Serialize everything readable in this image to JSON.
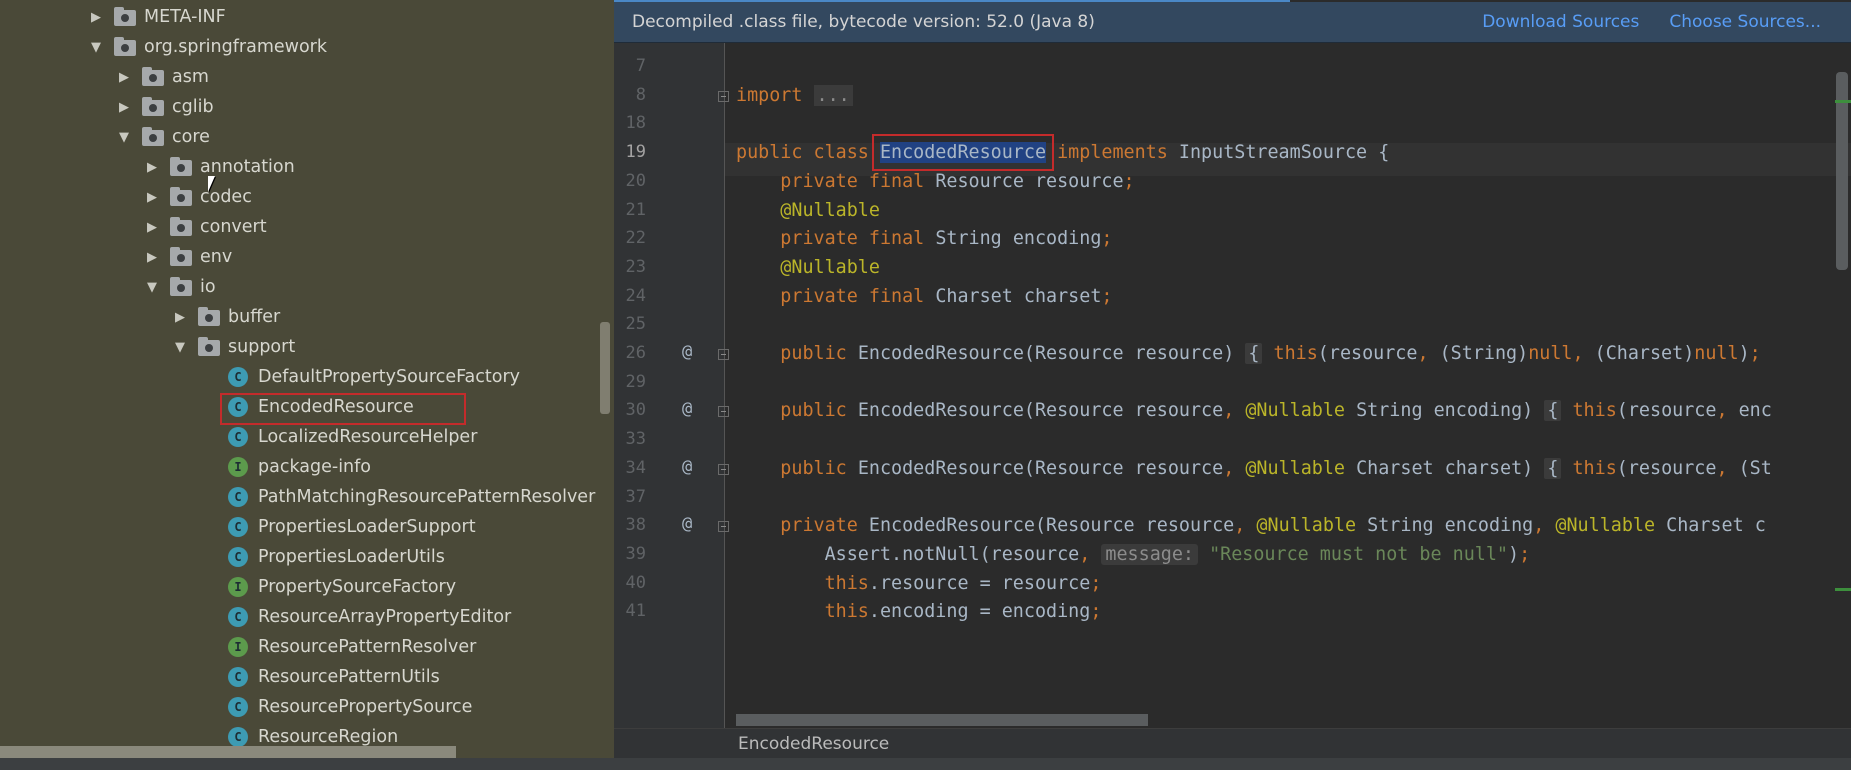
{
  "tree": {
    "rows": [
      {
        "depth": 0,
        "arrow": "right",
        "icon": "folder",
        "label": "META-INF"
      },
      {
        "depth": 0,
        "arrow": "down",
        "icon": "folder",
        "label": "org.springframework"
      },
      {
        "depth": 1,
        "arrow": "right",
        "icon": "folder",
        "label": "asm"
      },
      {
        "depth": 1,
        "arrow": "right",
        "icon": "folder",
        "label": "cglib"
      },
      {
        "depth": 1,
        "arrow": "down",
        "icon": "folder",
        "label": "core"
      },
      {
        "depth": 2,
        "arrow": "right",
        "icon": "folder",
        "label": "annotation"
      },
      {
        "depth": 2,
        "arrow": "right",
        "icon": "folder",
        "label": "codec"
      },
      {
        "depth": 2,
        "arrow": "right",
        "icon": "folder",
        "label": "convert"
      },
      {
        "depth": 2,
        "arrow": "right",
        "icon": "folder",
        "label": "env"
      },
      {
        "depth": 2,
        "arrow": "down",
        "icon": "folder",
        "label": "io"
      },
      {
        "depth": 3,
        "arrow": "right",
        "icon": "folder",
        "label": "buffer"
      },
      {
        "depth": 3,
        "arrow": "down",
        "icon": "folder",
        "label": "support"
      },
      {
        "depth": 4,
        "arrow": "none",
        "icon": "class",
        "label": "DefaultPropertySourceFactory"
      },
      {
        "depth": 4,
        "arrow": "none",
        "icon": "class",
        "label": "EncodedResource",
        "selected": true
      },
      {
        "depth": 4,
        "arrow": "none",
        "icon": "class",
        "label": "LocalizedResourceHelper"
      },
      {
        "depth": 4,
        "arrow": "none",
        "icon": "interface",
        "label": "package-info"
      },
      {
        "depth": 4,
        "arrow": "none",
        "icon": "class",
        "label": "PathMatchingResourcePatternResolver"
      },
      {
        "depth": 4,
        "arrow": "none",
        "icon": "class",
        "label": "PropertiesLoaderSupport"
      },
      {
        "depth": 4,
        "arrow": "none",
        "icon": "class",
        "label": "PropertiesLoaderUtils"
      },
      {
        "depth": 4,
        "arrow": "none",
        "icon": "interface",
        "label": "PropertySourceFactory"
      },
      {
        "depth": 4,
        "arrow": "none",
        "icon": "class",
        "label": "ResourceArrayPropertyEditor"
      },
      {
        "depth": 4,
        "arrow": "none",
        "icon": "interface",
        "label": "ResourcePatternResolver"
      },
      {
        "depth": 4,
        "arrow": "none",
        "icon": "class",
        "label": "ResourcePatternUtils"
      },
      {
        "depth": 4,
        "arrow": "none",
        "icon": "class",
        "label": "ResourcePropertySource"
      },
      {
        "depth": 4,
        "arrow": "none",
        "icon": "class",
        "label": "ResourceRegion"
      }
    ]
  },
  "banner": {
    "message": "Decompiled .class file, bytecode version: 52.0 (Java 8)",
    "download_sources": "Download Sources",
    "choose_sources": "Choose Sources..."
  },
  "editor": {
    "current_line": "19",
    "lines": [
      {
        "n": "7",
        "mark": "",
        "fold": false,
        "html": ""
      },
      {
        "n": "8",
        "mark": "",
        "fold": true,
        "html": "<span class=\"kw\">import </span><span class=\"dots\">...</span>"
      },
      {
        "n": "18",
        "mark": "",
        "fold": false,
        "html": ""
      },
      {
        "n": "19",
        "mark": "",
        "fold": false,
        "html": "<span class=\"kw\">public class </span><span class=\"hl\">EncodedResource</span> <span class=\"kw\">implements </span>InputStreamSource {"
      },
      {
        "n": "20",
        "mark": "",
        "fold": false,
        "html": "    <span class=\"kw\">private final </span>Resource resource<span class=\"kw\">;</span>"
      },
      {
        "n": "21",
        "mark": "",
        "fold": false,
        "html": "    <span class=\"ann\">@Nullable</span>"
      },
      {
        "n": "22",
        "mark": "",
        "fold": false,
        "html": "    <span class=\"kw\">private final </span>String encoding<span class=\"kw\">;</span>"
      },
      {
        "n": "23",
        "mark": "",
        "fold": false,
        "html": "    <span class=\"ann\">@Nullable</span>"
      },
      {
        "n": "24",
        "mark": "",
        "fold": false,
        "html": "    <span class=\"kw\">private final </span>Charset charset<span class=\"kw\">;</span>"
      },
      {
        "n": "25",
        "mark": "",
        "fold": false,
        "html": ""
      },
      {
        "n": "26",
        "mark": "@",
        "fold": true,
        "html": "    <span class=\"kw\">public </span>EncodedResource(Resource resource) <span class=\"brace\">{</span> <span class=\"kw\">this</span>(resource<span class=\"kw\">, </span>(String)<span class=\"kw\">null, </span>(Charset)<span class=\"kw\">null</span>)<span class=\"kw\">;</span>"
      },
      {
        "n": "29",
        "mark": "",
        "fold": false,
        "html": ""
      },
      {
        "n": "30",
        "mark": "@",
        "fold": true,
        "html": "    <span class=\"kw\">public </span>EncodedResource(Resource resource<span class=\"kw\">, </span><span class=\"ann\">@Nullable </span>String encoding) <span class=\"brace\">{</span> <span class=\"kw\">this</span>(resource<span class=\"kw\">, </span>enc"
      },
      {
        "n": "33",
        "mark": "",
        "fold": false,
        "html": ""
      },
      {
        "n": "34",
        "mark": "@",
        "fold": true,
        "html": "    <span class=\"kw\">public </span>EncodedResource(Resource resource<span class=\"kw\">, </span><span class=\"ann\">@Nullable </span>Charset charset) <span class=\"brace\">{</span> <span class=\"kw\">this</span>(resource<span class=\"kw\">, </span>(St"
      },
      {
        "n": "37",
        "mark": "",
        "fold": false,
        "html": ""
      },
      {
        "n": "38",
        "mark": "@",
        "fold": true,
        "html": "    <span class=\"kw\">private </span>EncodedResource(Resource resource<span class=\"kw\">, </span><span class=\"ann\">@Nullable </span>String encoding<span class=\"kw\">, </span><span class=\"ann\">@Nullable </span>Charset c"
      },
      {
        "n": "39",
        "mark": "",
        "fold": false,
        "html": "        Assert.notNull(resource<span class=\"kw\">, </span><span class=\"hint\">message:</span> <span class=\"str\">\"Resource must not be null\"</span>)<span class=\"kw\">;</span>"
      },
      {
        "n": "40",
        "mark": "",
        "fold": false,
        "html": "        <span class=\"kw\">this</span>.resource = resource<span class=\"kw\">;</span>"
      },
      {
        "n": "41",
        "mark": "",
        "fold": false,
        "html": "        <span class=\"kw\">this</span>.encoding = encoding<span class=\"kw\">;</span>"
      }
    ]
  },
  "breadcrumb": {
    "label": "EncodedResource"
  },
  "colors": {
    "tree_bg": "#4a4938",
    "editor_bg": "#2b2b2b",
    "banner_bg": "#33485f",
    "keyword": "#cc7832",
    "annotation": "#bbb529",
    "string": "#6a8759",
    "selection_outline": "#c42b2b"
  }
}
